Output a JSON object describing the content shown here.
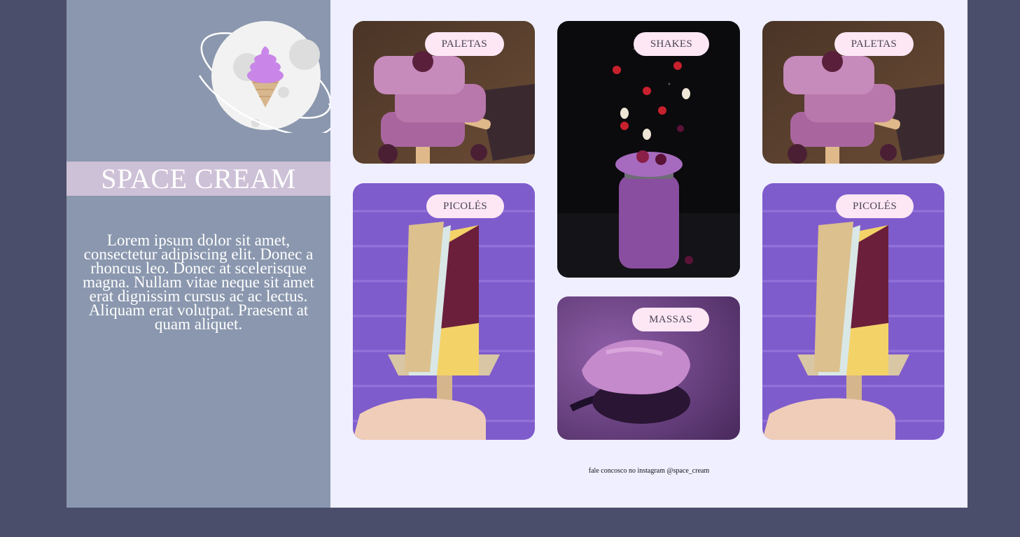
{
  "sidebar": {
    "brand": "SPACE CREAM",
    "description": "Lorem ipsum dolor sit amet, consectetur adipiscing elit. Donec a rhoncus leo. Donec at scelerisque magna. Nullam vitae neque sit amet erat dignissim cursus ac ac lectus. Aliquam erat volutpat. Praesent at quam aliquet."
  },
  "cards": [
    {
      "label": "PALETAS"
    },
    {
      "label": "SHAKES"
    },
    {
      "label": "PALETAS"
    },
    {
      "label": "PICOLÉS"
    },
    {
      "label": "MASSAS"
    },
    {
      "label": "PICOLÉS"
    }
  ],
  "footer": {
    "text": "fale concosco no instagram @space_cream"
  },
  "colors": {
    "background": "#4b4e6b",
    "sidebar": "#8a97ae",
    "brand_band": "#cdc1d7",
    "main": "#efefff",
    "pill": "#fde7f4"
  }
}
